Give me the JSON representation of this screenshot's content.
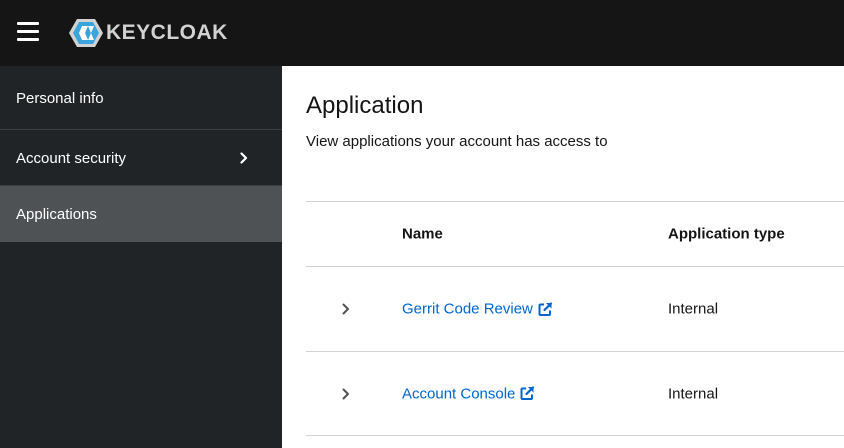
{
  "header": {
    "brand": "KEYCLOAK",
    "colors": {
      "background": "#151515",
      "logo_blue": "#39a5dc",
      "logo_light": "#d2d2d2"
    }
  },
  "sidebar": {
    "items": [
      {
        "label": "Personal info",
        "active": false,
        "has_children": false
      },
      {
        "label": "Account security",
        "active": false,
        "has_children": true
      },
      {
        "label": "Applications",
        "active": true,
        "has_children": false
      }
    ]
  },
  "main": {
    "title": "Application",
    "description": "View applications your account has access to",
    "table": {
      "columns": [
        "Name",
        "Application type"
      ],
      "rows": [
        {
          "name": "Gerrit Code Review",
          "type": "Internal",
          "external_link": true
        },
        {
          "name": "Account Console",
          "type": "Internal",
          "external_link": true
        }
      ]
    },
    "colors": {
      "link": "#0066cc",
      "text": "#151515",
      "border": "#d2d2d2"
    }
  }
}
